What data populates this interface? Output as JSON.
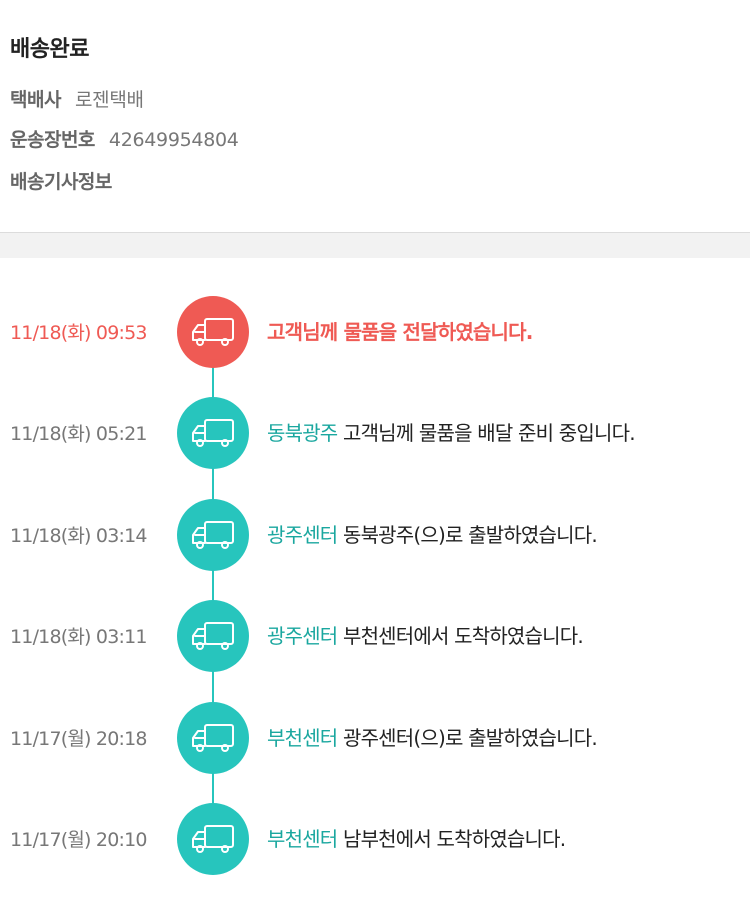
{
  "delivery": {
    "status": "배송완료",
    "courier_label": "택배사",
    "courier_value": "로젠택배",
    "tracking_label": "운송장번호",
    "tracking_value": "42649954804",
    "driver_label": "배송기사정보"
  },
  "colors": {
    "current": "#ef5a54",
    "teal": "#27c5bd",
    "location_text": "#1aa79f"
  },
  "timeline": [
    {
      "time": "11/18(화) 09:53",
      "location": "",
      "message": "고객님께 물품을 전달하였습니다.",
      "icon": "truck-icon",
      "current": true
    },
    {
      "time": "11/18(화) 05:21",
      "location": "동북광주",
      "message": " 고객님께 물품을 배달 준비 중입니다.",
      "icon": "truck-icon",
      "current": false
    },
    {
      "time": "11/18(화) 03:14",
      "location": "광주센터",
      "message": " 동북광주(으)로 출발하였습니다.",
      "icon": "truck-icon",
      "current": false
    },
    {
      "time": "11/18(화) 03:11",
      "location": "광주센터",
      "message": " 부천센터에서 도착하였습니다.",
      "icon": "truck-icon",
      "current": false
    },
    {
      "time": "11/17(월) 20:18",
      "location": "부천센터",
      "message": " 광주센터(으)로 출발하였습니다.",
      "icon": "truck-icon",
      "current": false
    },
    {
      "time": "11/17(월) 20:10",
      "location": "부천센터",
      "message": " 남부천에서 도착하였습니다.",
      "icon": "truck-icon",
      "current": false
    }
  ]
}
